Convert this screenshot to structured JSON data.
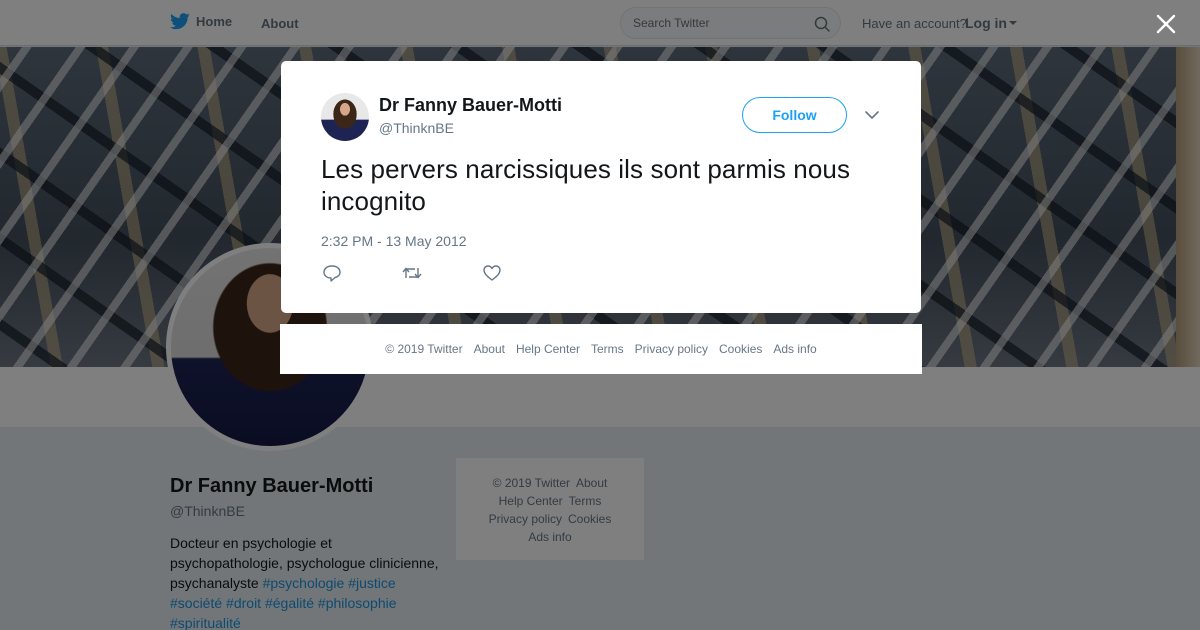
{
  "nav": {
    "home_label": "Home",
    "about_label": "About",
    "search_placeholder": "Search Twitter",
    "account_prompt": "Have an account?",
    "login_label": "Log in"
  },
  "profile": {
    "name": "Dr Fanny Bauer-Motti",
    "handle": "@ThinknBE",
    "bio_text": "Docteur en psychologie et psychopathologie, psychologue clinicienne, psychanalyste ",
    "hashtags": [
      "#psychologie",
      "#justice",
      "#société",
      "#droit",
      "#égalité",
      "#philosophie",
      "#spiritualité"
    ]
  },
  "side_footer": {
    "links": [
      "© 2019 Twitter",
      "About",
      "Help Center",
      "Terms",
      "Privacy policy",
      "Cookies",
      "Ads info"
    ]
  },
  "tweet": {
    "author_name": "Dr Fanny Bauer-Motti",
    "author_handle": "@ThinknBE",
    "follow_label": "Follow",
    "text": "Les pervers narcissiques ils sont parmis nous incognito",
    "timestamp": "2:32 PM - 13 May 2012"
  },
  "modal_footer": {
    "links": [
      "© 2019 Twitter",
      "About",
      "Help Center",
      "Terms",
      "Privacy policy",
      "Cookies",
      "Ads info"
    ]
  },
  "colors": {
    "accent": "#1da1f2",
    "link": "#1b95e0",
    "secondary_text": "#657786",
    "primary_text": "#14171a"
  },
  "icons": {
    "brand": "twitter-bird-icon",
    "search": "search-icon",
    "close": "close-icon",
    "caret": "chevron-down-icon",
    "reply": "reply-icon",
    "retweet": "retweet-icon",
    "like": "heart-icon"
  }
}
